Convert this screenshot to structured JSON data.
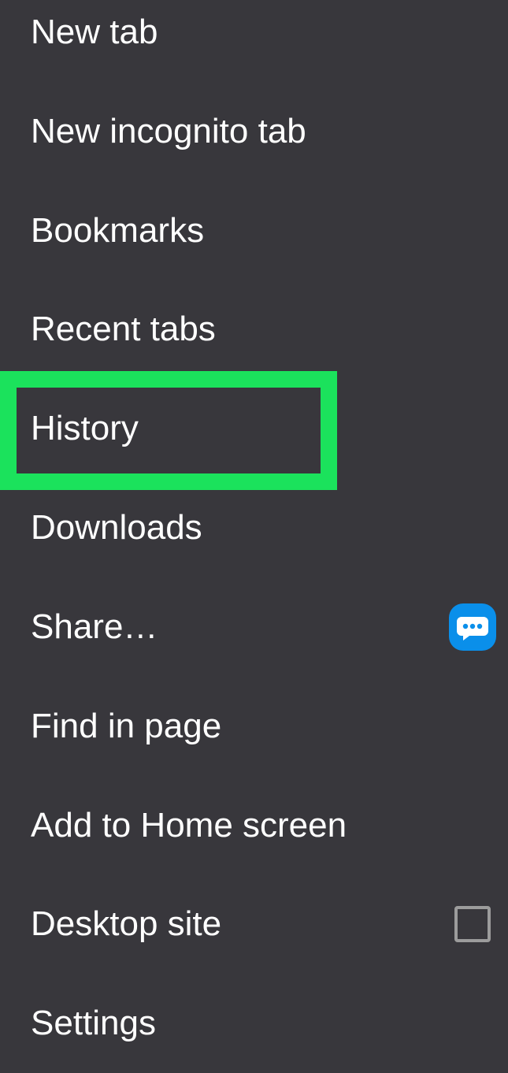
{
  "menu": {
    "items": [
      {
        "label": "New tab"
      },
      {
        "label": "New incognito tab"
      },
      {
        "label": "Bookmarks"
      },
      {
        "label": "Recent tabs"
      },
      {
        "label": "History"
      },
      {
        "label": "Downloads"
      },
      {
        "label": "Share…",
        "trailing_icon": "chat-bubble-icon"
      },
      {
        "label": "Find in page"
      },
      {
        "label": "Add to Home screen"
      },
      {
        "label": "Desktop site",
        "checkbox_checked": false
      },
      {
        "label": "Settings"
      }
    ],
    "highlighted_item": "History"
  },
  "colors": {
    "background": "#38373C",
    "text": "#FFFFFF",
    "highlight": "#1BE25C",
    "share_icon": "#0A8FEA",
    "checkbox_border": "#9C9C9C"
  }
}
